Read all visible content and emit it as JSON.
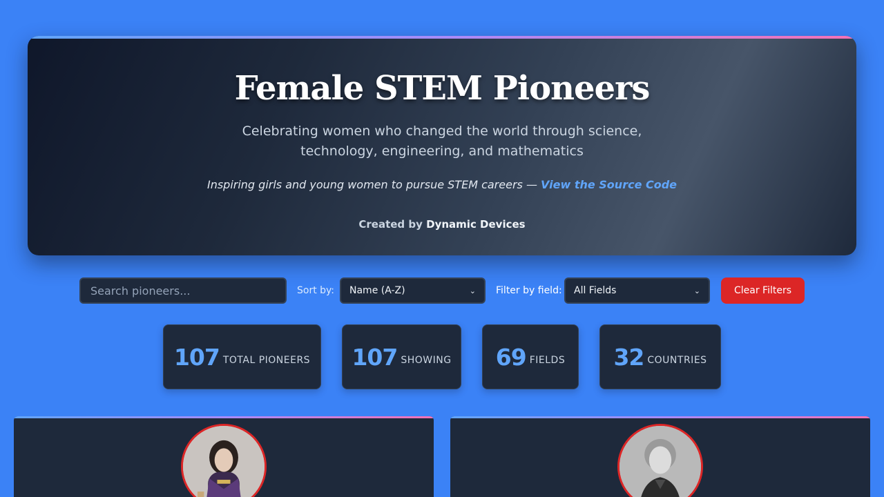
{
  "hero": {
    "title": "Female STEM Pioneers",
    "subtitle": "Celebrating women who changed the world through science, technology, engineering, and mathematics",
    "tagline_text": "Inspiring girls and young women to pursue STEM careers — ",
    "tagline_link": "View the Source Code",
    "credit_prefix": "Created by ",
    "credit_author": "Dynamic Devices"
  },
  "controls": {
    "search_placeholder": "Search pioneers...",
    "sort_label": "Sort by:",
    "sort_value": "Name (A-Z)",
    "filter_label": "Filter by field:",
    "filter_value": "All Fields",
    "clear_label": "Clear Filters"
  },
  "stats": [
    {
      "value": "107",
      "label": "TOTAL PIONEERS"
    },
    {
      "value": "107",
      "label": "SHOWING"
    },
    {
      "value": "69",
      "label": "FIELDS"
    },
    {
      "value": "32",
      "label": "COUNTRIES"
    }
  ],
  "colors": {
    "background": "#3b82f6",
    "panel": "#1e293b",
    "accent": "#60a5fa",
    "danger": "#dc2626"
  }
}
